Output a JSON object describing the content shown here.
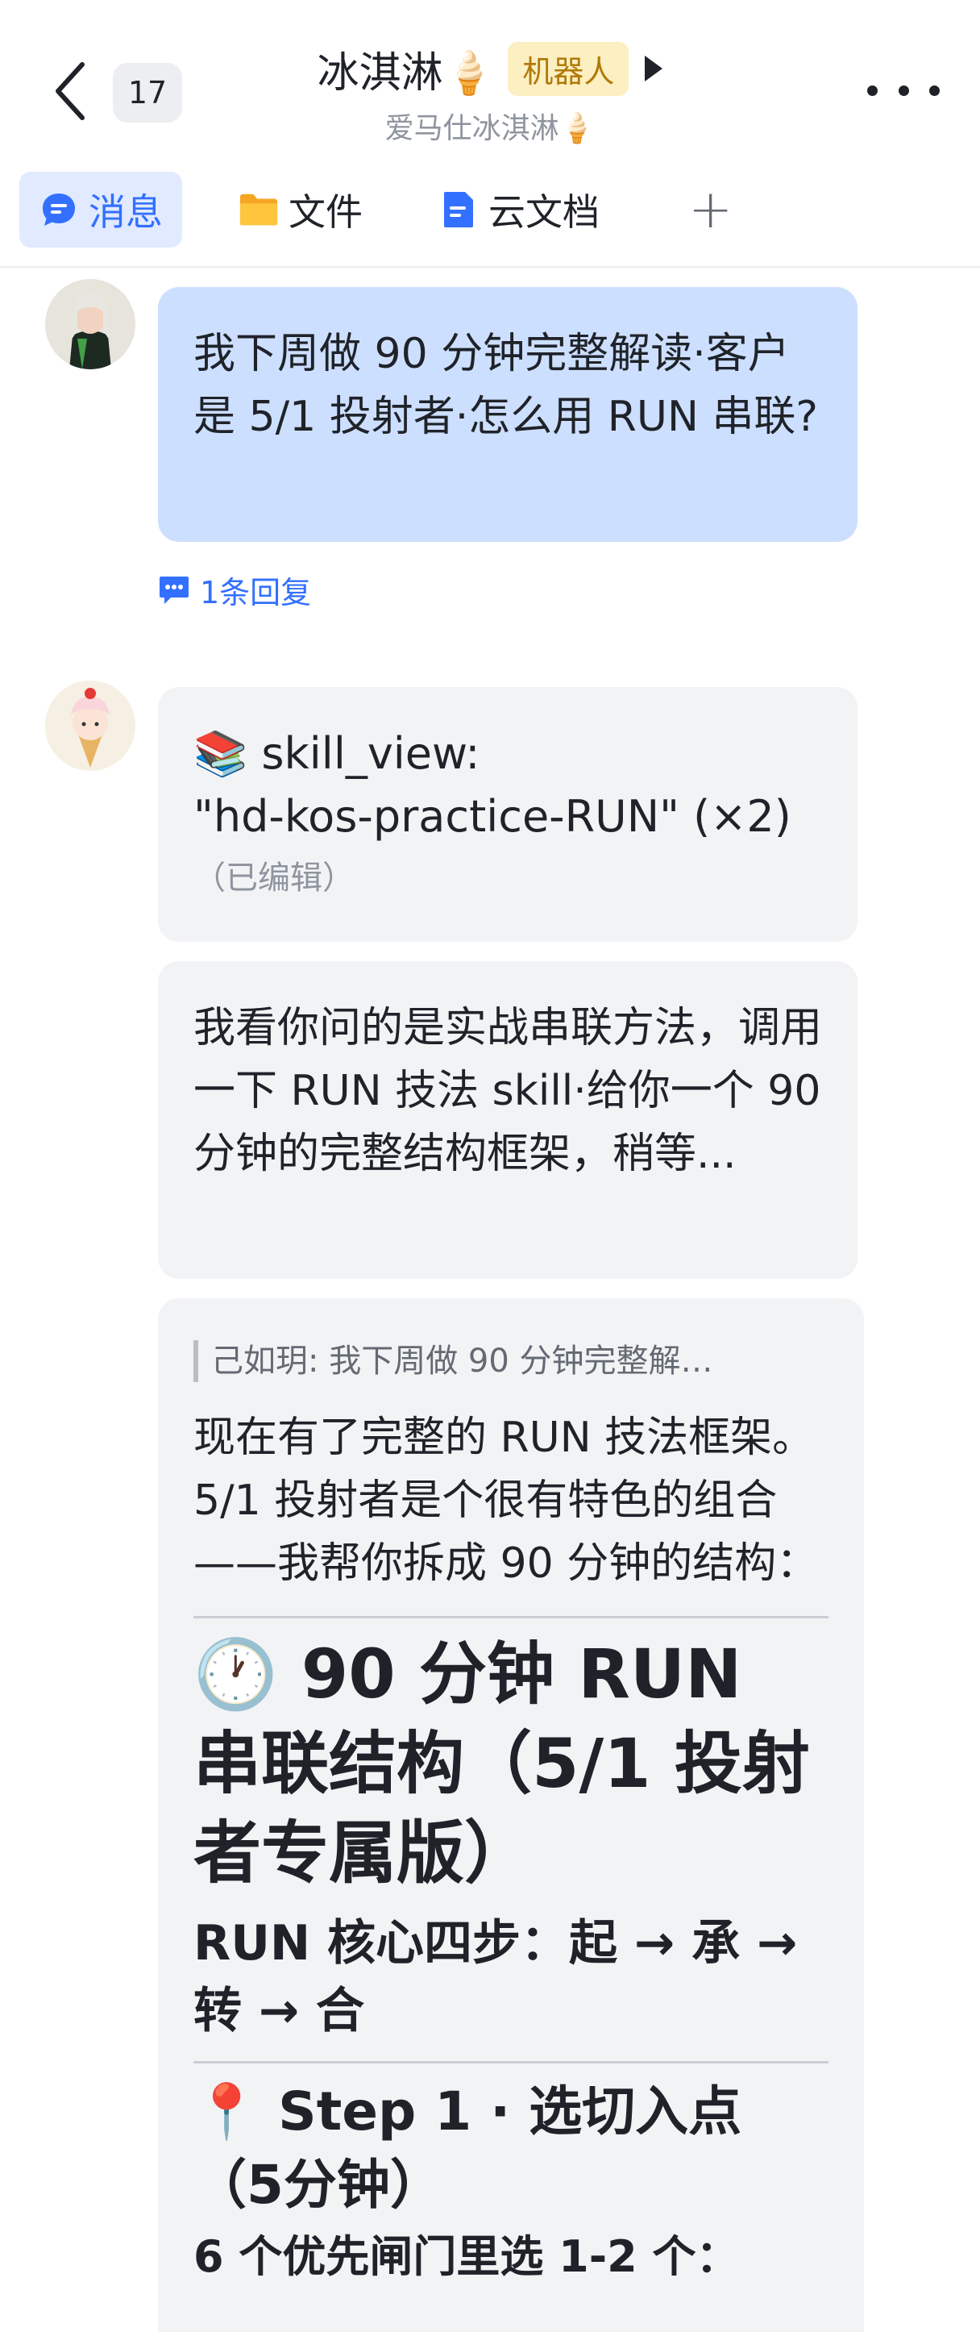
{
  "header": {
    "unread_count": "17",
    "chat_title": "冰淇淋🍦",
    "bot_tag": "机器人",
    "subtitle": "爱马仕冰淇淋🍦"
  },
  "tabs": [
    {
      "label": "消息",
      "icon": "message-icon",
      "active": true
    },
    {
      "label": "文件",
      "icon": "folder-icon",
      "active": false
    },
    {
      "label": "云文档",
      "icon": "doc-icon",
      "active": false
    }
  ],
  "messages": {
    "user_question": "我下周做 90 分钟完整解读·客户是 5/1 投射者·怎么用 RUN 串联?",
    "reply_count": "1条回复",
    "bot_skill_line1": "📚 skill_view:",
    "bot_skill_line2": "\"hd-kos-practice-RUN\" (×2)",
    "bot_edited": "（已编辑）",
    "bot_intro": "我看你问的是实战串联方法，调用一下 RUN 技法 skill·给你一个 90 分钟的完整结构框架，稍等...",
    "quote": "己如玥: 我下周做 90 分钟完整解…",
    "answer_intro": "现在有了完整的 RUN 技法框架。5/1 投射者是个很有特色的组合——我帮你拆成 90 分钟的结构：",
    "heading_main": "🕐 90 分钟 RUN 串联结构（5/1 投射者专属版）",
    "core_steps": "RUN 核心四步：起 → 承 → 转 → 合",
    "step1_heading": "📍 Step 1 · 选切入点（5分钟）",
    "step1_text": "6 个优先闸门里选 1-2 个："
  }
}
